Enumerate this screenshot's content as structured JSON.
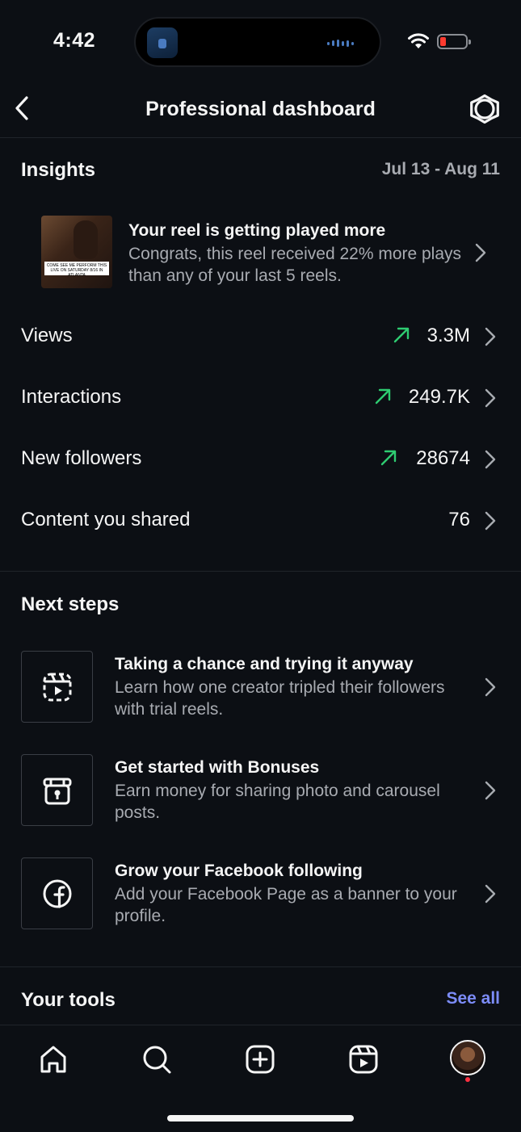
{
  "status_bar": {
    "time": "4:42"
  },
  "header": {
    "title": "Professional dashboard"
  },
  "insights": {
    "title": "Insights",
    "date_range": "Jul 13 - Aug 11",
    "reel_card": {
      "title": "Your reel is getting played more",
      "description": "Congrats, this reel received 22% more plays than any of your last 5 reels.",
      "thumbnail_caption": "COME SEE ME PERFORM THIS LIVE ON SATURDAY 8/16 IN ATLANTA"
    },
    "metrics": [
      {
        "label": "Views",
        "value": "3.3M",
        "trend": "up"
      },
      {
        "label": "Interactions",
        "value": "249.7K",
        "trend": "up"
      },
      {
        "label": "New followers",
        "value": "28674",
        "trend": "up"
      },
      {
        "label": "Content you shared",
        "value": "76",
        "trend": "none"
      }
    ]
  },
  "next_steps": {
    "title": "Next steps",
    "items": [
      {
        "icon": "trial-reels-icon",
        "title": "Taking a chance and trying it anyway",
        "description": "Learn how one creator tripled their followers with trial reels."
      },
      {
        "icon": "bonuses-icon",
        "title": "Get started with Bonuses",
        "description": "Earn money for sharing photo and carousel posts."
      },
      {
        "icon": "facebook-icon",
        "title": "Grow your Facebook following",
        "description": "Add your Facebook Page as a banner to your profile."
      }
    ]
  },
  "tools": {
    "title": "Your tools",
    "see_all": "See all"
  },
  "bottom_nav": [
    "home-icon",
    "search-icon",
    "create-icon",
    "reels-icon",
    "profile-avatar"
  ],
  "colors": {
    "background": "#0c0f14",
    "trend_up": "#2ecc71",
    "link": "#7c8cf8",
    "secondary_text": "#a8abb1",
    "notification_dot": "#ff3040"
  }
}
